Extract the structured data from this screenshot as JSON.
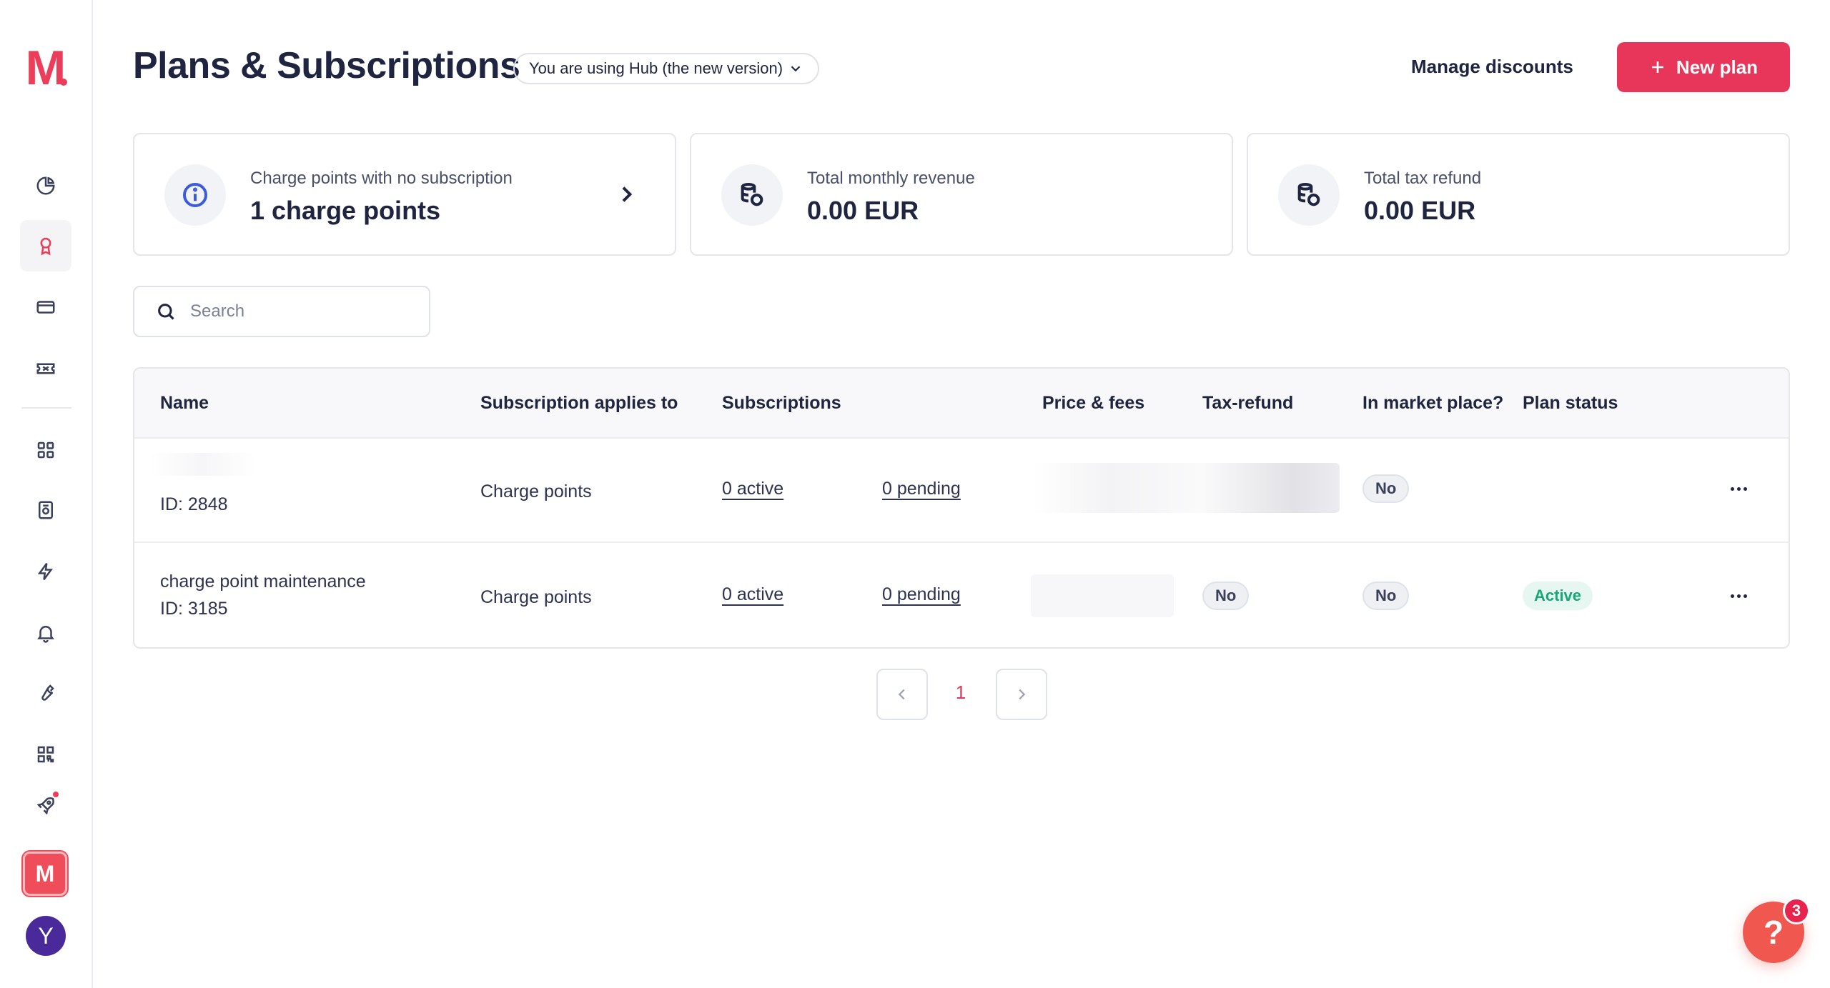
{
  "app": {
    "logo_letter": "M",
    "brand_tile_letter": "M",
    "avatar_letter": "Y"
  },
  "colors": {
    "accent": "#e8365a",
    "active_status": "#16a877",
    "avatar": "#4a2a9b"
  },
  "sidebar": {
    "items": [
      {
        "icon": "dashboard-icon",
        "active": false
      },
      {
        "icon": "award-icon",
        "active": true
      },
      {
        "icon": "credit-card-icon",
        "active": false
      },
      {
        "icon": "ticket-icon",
        "active": false
      },
      {
        "icon": "grid-icon",
        "active": false
      },
      {
        "icon": "charger-icon",
        "active": false
      },
      {
        "icon": "bolt-icon",
        "active": false
      },
      {
        "icon": "bell-icon",
        "active": false
      },
      {
        "icon": "wrench-icon",
        "active": false
      },
      {
        "icon": "qr-code-icon",
        "active": false
      },
      {
        "icon": "rocket-icon",
        "active": false
      }
    ]
  },
  "header": {
    "title": "Plans & Subscriptions",
    "version_label": "You are using Hub (the new version)",
    "manage_discounts": "Manage discounts",
    "new_plan": "New plan"
  },
  "cards": [
    {
      "icon": "info-icon",
      "label": "Charge points with no subscription",
      "value": "1 charge points"
    },
    {
      "icon": "coins-icon",
      "label": "Total monthly revenue",
      "value": "0.00 EUR"
    },
    {
      "icon": "coins-icon",
      "label": "Total tax refund",
      "value": "0.00 EUR"
    }
  ],
  "search": {
    "placeholder": "Search"
  },
  "table": {
    "columns": [
      "Name",
      "Subscription applies to",
      "Subscriptions",
      "Price & fees",
      "Tax-refund",
      "In market place?",
      "Plan status"
    ],
    "rows": [
      {
        "name": "",
        "id": "ID: 2848",
        "applies_to": "Charge points",
        "active": "0 active",
        "pending": "0 pending",
        "tax_refund": "",
        "marketplace": "No",
        "status": ""
      },
      {
        "name": "charge point maintenance",
        "id": "ID: 3185",
        "applies_to": "Charge points",
        "active": "0 active",
        "pending": "0 pending",
        "tax_refund": "No",
        "marketplace": "No",
        "status": "Active"
      }
    ]
  },
  "pagination": {
    "current_page": "1"
  },
  "help": {
    "label": "?",
    "badge": "3"
  }
}
